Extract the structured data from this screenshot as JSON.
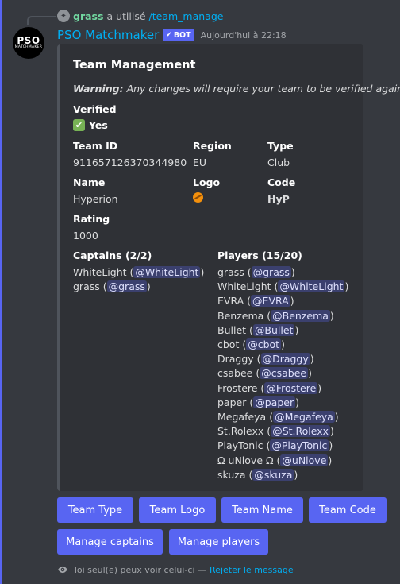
{
  "reply": {
    "user": "grass",
    "action": "a utilisé",
    "command": "/team_manage"
  },
  "message": {
    "avatar_text_big": "PSO",
    "avatar_text_small": "MATCHMAKER",
    "username": "PSO Matchmaker",
    "bot_tag": "BOT",
    "timestamp": "Aujourd'hui à 22:18"
  },
  "embed": {
    "title": "Team Management",
    "warning_label": "Warning:",
    "warning_text": "Any changes will require your team to be verified again",
    "verified_label": "Verified",
    "verified_value": "Yes",
    "team_id_label": "Team ID",
    "team_id_value": "911657126370344980",
    "region_label": "Region",
    "region_value": "EU",
    "type_label": "Type",
    "type_value": "Club",
    "name_label": "Name",
    "name_value": "Hyperion",
    "logo_label": "Logo",
    "code_label": "Code",
    "code_value": "HyP",
    "rating_label": "Rating",
    "rating_value": "1000",
    "captains_label": "Captains (2/2)",
    "captains": [
      {
        "name": "WhiteLight",
        "mention": "@WhiteLight"
      },
      {
        "name": "grass",
        "mention": "@grass"
      }
    ],
    "players_label": "Players (15/20)",
    "players": [
      {
        "name": "grass",
        "mention": "@grass"
      },
      {
        "name": "WhiteLight",
        "mention": "@WhiteLight"
      },
      {
        "name": "EVRA",
        "mention": "@EVRA"
      },
      {
        "name": "Benzema",
        "mention": "@Benzema"
      },
      {
        "name": "Bullet",
        "mention": "@Bullet"
      },
      {
        "name": "cbot",
        "mention": "@cbot"
      },
      {
        "name": "Draggy",
        "mention": "@Draggy"
      },
      {
        "name": "csabee",
        "mention": "@csabee"
      },
      {
        "name": "Frostere",
        "mention": "@Frostere"
      },
      {
        "name": "paper",
        "mention": "@paper"
      },
      {
        "name": "Megafeya",
        "mention": "@Megafeya"
      },
      {
        "name": "St.Rolexx",
        "mention": "@St.Rolexx"
      },
      {
        "name": "PlayTonic",
        "mention": "@PlayTonic"
      },
      {
        "name": "Ω uNlove Ω",
        "mention": "@uNlove"
      },
      {
        "name": "skuza",
        "mention": "@skuza"
      }
    ]
  },
  "buttons": {
    "team_type": "Team Type",
    "team_logo": "Team Logo",
    "team_name": "Team Name",
    "team_code": "Team Code",
    "manage_captains": "Manage captains",
    "manage_players": "Manage players"
  },
  "footer": {
    "text": "Toi seul(e) peux voir celui-ci —",
    "dismiss": "Rejeter le message"
  },
  "colors": {
    "background": "#36393f",
    "embed_bg": "#2f3136",
    "blurple": "#5865f2",
    "link": "#00b0f4",
    "check_green": "#77b255"
  }
}
